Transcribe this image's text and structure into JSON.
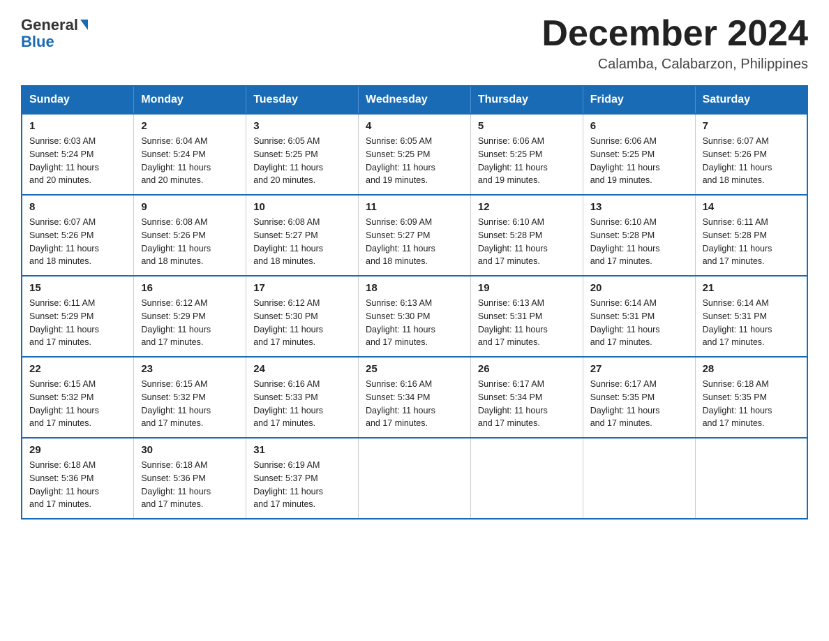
{
  "header": {
    "logo_general": "General",
    "logo_blue": "Blue",
    "month_title": "December 2024",
    "location": "Calamba, Calabarzon, Philippines"
  },
  "days_of_week": [
    "Sunday",
    "Monday",
    "Tuesday",
    "Wednesday",
    "Thursday",
    "Friday",
    "Saturday"
  ],
  "weeks": [
    [
      {
        "day": "1",
        "sunrise": "6:03 AM",
        "sunset": "5:24 PM",
        "daylight": "11 hours and 20 minutes."
      },
      {
        "day": "2",
        "sunrise": "6:04 AM",
        "sunset": "5:24 PM",
        "daylight": "11 hours and 20 minutes."
      },
      {
        "day": "3",
        "sunrise": "6:05 AM",
        "sunset": "5:25 PM",
        "daylight": "11 hours and 20 minutes."
      },
      {
        "day": "4",
        "sunrise": "6:05 AM",
        "sunset": "5:25 PM",
        "daylight": "11 hours and 19 minutes."
      },
      {
        "day": "5",
        "sunrise": "6:06 AM",
        "sunset": "5:25 PM",
        "daylight": "11 hours and 19 minutes."
      },
      {
        "day": "6",
        "sunrise": "6:06 AM",
        "sunset": "5:25 PM",
        "daylight": "11 hours and 19 minutes."
      },
      {
        "day": "7",
        "sunrise": "6:07 AM",
        "sunset": "5:26 PM",
        "daylight": "11 hours and 18 minutes."
      }
    ],
    [
      {
        "day": "8",
        "sunrise": "6:07 AM",
        "sunset": "5:26 PM",
        "daylight": "11 hours and 18 minutes."
      },
      {
        "day": "9",
        "sunrise": "6:08 AM",
        "sunset": "5:26 PM",
        "daylight": "11 hours and 18 minutes."
      },
      {
        "day": "10",
        "sunrise": "6:08 AM",
        "sunset": "5:27 PM",
        "daylight": "11 hours and 18 minutes."
      },
      {
        "day": "11",
        "sunrise": "6:09 AM",
        "sunset": "5:27 PM",
        "daylight": "11 hours and 18 minutes."
      },
      {
        "day": "12",
        "sunrise": "6:10 AM",
        "sunset": "5:28 PM",
        "daylight": "11 hours and 17 minutes."
      },
      {
        "day": "13",
        "sunrise": "6:10 AM",
        "sunset": "5:28 PM",
        "daylight": "11 hours and 17 minutes."
      },
      {
        "day": "14",
        "sunrise": "6:11 AM",
        "sunset": "5:28 PM",
        "daylight": "11 hours and 17 minutes."
      }
    ],
    [
      {
        "day": "15",
        "sunrise": "6:11 AM",
        "sunset": "5:29 PM",
        "daylight": "11 hours and 17 minutes."
      },
      {
        "day": "16",
        "sunrise": "6:12 AM",
        "sunset": "5:29 PM",
        "daylight": "11 hours and 17 minutes."
      },
      {
        "day": "17",
        "sunrise": "6:12 AM",
        "sunset": "5:30 PM",
        "daylight": "11 hours and 17 minutes."
      },
      {
        "day": "18",
        "sunrise": "6:13 AM",
        "sunset": "5:30 PM",
        "daylight": "11 hours and 17 minutes."
      },
      {
        "day": "19",
        "sunrise": "6:13 AM",
        "sunset": "5:31 PM",
        "daylight": "11 hours and 17 minutes."
      },
      {
        "day": "20",
        "sunrise": "6:14 AM",
        "sunset": "5:31 PM",
        "daylight": "11 hours and 17 minutes."
      },
      {
        "day": "21",
        "sunrise": "6:14 AM",
        "sunset": "5:31 PM",
        "daylight": "11 hours and 17 minutes."
      }
    ],
    [
      {
        "day": "22",
        "sunrise": "6:15 AM",
        "sunset": "5:32 PM",
        "daylight": "11 hours and 17 minutes."
      },
      {
        "day": "23",
        "sunrise": "6:15 AM",
        "sunset": "5:32 PM",
        "daylight": "11 hours and 17 minutes."
      },
      {
        "day": "24",
        "sunrise": "6:16 AM",
        "sunset": "5:33 PM",
        "daylight": "11 hours and 17 minutes."
      },
      {
        "day": "25",
        "sunrise": "6:16 AM",
        "sunset": "5:34 PM",
        "daylight": "11 hours and 17 minutes."
      },
      {
        "day": "26",
        "sunrise": "6:17 AM",
        "sunset": "5:34 PM",
        "daylight": "11 hours and 17 minutes."
      },
      {
        "day": "27",
        "sunrise": "6:17 AM",
        "sunset": "5:35 PM",
        "daylight": "11 hours and 17 minutes."
      },
      {
        "day": "28",
        "sunrise": "6:18 AM",
        "sunset": "5:35 PM",
        "daylight": "11 hours and 17 minutes."
      }
    ],
    [
      {
        "day": "29",
        "sunrise": "6:18 AM",
        "sunset": "5:36 PM",
        "daylight": "11 hours and 17 minutes."
      },
      {
        "day": "30",
        "sunrise": "6:18 AM",
        "sunset": "5:36 PM",
        "daylight": "11 hours and 17 minutes."
      },
      {
        "day": "31",
        "sunrise": "6:19 AM",
        "sunset": "5:37 PM",
        "daylight": "11 hours and 17 minutes."
      },
      null,
      null,
      null,
      null
    ]
  ],
  "labels": {
    "sunrise": "Sunrise:",
    "sunset": "Sunset:",
    "daylight": "Daylight:"
  }
}
